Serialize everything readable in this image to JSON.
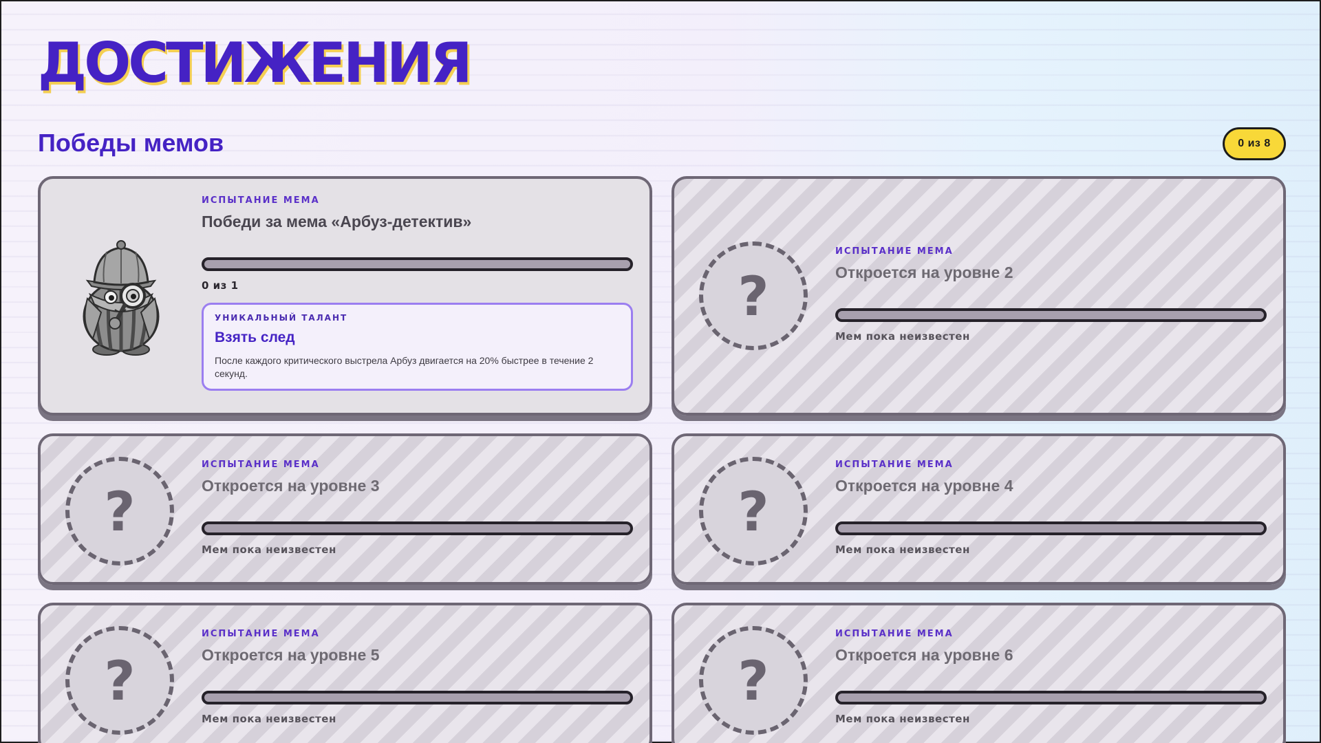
{
  "page": {
    "title": "ДОСТИЖЕНИЯ"
  },
  "section": {
    "title": "Победы мемов",
    "count": "0 из 8"
  },
  "cards": [
    {
      "kind": "ИСПЫТАНИЕ МЕМА",
      "name": "Победи за мема «Арбуз-детектив»",
      "progress": 0,
      "progress_text": "0 из 1",
      "talent": {
        "kind": "УНИКАЛЬНЫЙ ТАЛАНТ",
        "name": "Взять след",
        "description": "После каждого критического выстрела Арбуз двигается на 20% быстрее в течение 2 секунд."
      }
    },
    {
      "kind": "ИСПЫТАНИЕ МЕМА",
      "name": "Откроется на уровне 2",
      "progress": 0,
      "progress_text": "Мем пока неизвестен",
      "icon": "?"
    },
    {
      "kind": "ИСПЫТАНИЕ МЕМА",
      "name": "Откроется на уровне 3",
      "progress": 0,
      "progress_text": "Мем пока неизвестен",
      "icon": "?"
    },
    {
      "kind": "ИСПЫТАНИЕ МЕМА",
      "name": "Откроется на уровне 4",
      "progress": 0,
      "progress_text": "Мем пока неизвестен",
      "icon": "?"
    },
    {
      "kind": "ИСПЫТАНИЕ МЕМА",
      "name": "Откроется на уровне 5",
      "progress": 0,
      "progress_text": "Мем пока неизвестен",
      "icon": "?"
    },
    {
      "kind": "ИСПЫТАНИЕ МЕМА",
      "name": "Откроется на уровне 6",
      "progress": 0,
      "progress_text": "Мем пока неизвестен",
      "icon": "?"
    }
  ],
  "colors": {
    "accent": "#4522c4",
    "title_shadow": "#f4cf53",
    "badge": "#f8d838",
    "talent_border": "#9b7ef0",
    "card_border": "#6e6775"
  },
  "icons": {
    "avatar": "watermelon-detective-avatar",
    "locked": "question-mark-icon"
  }
}
